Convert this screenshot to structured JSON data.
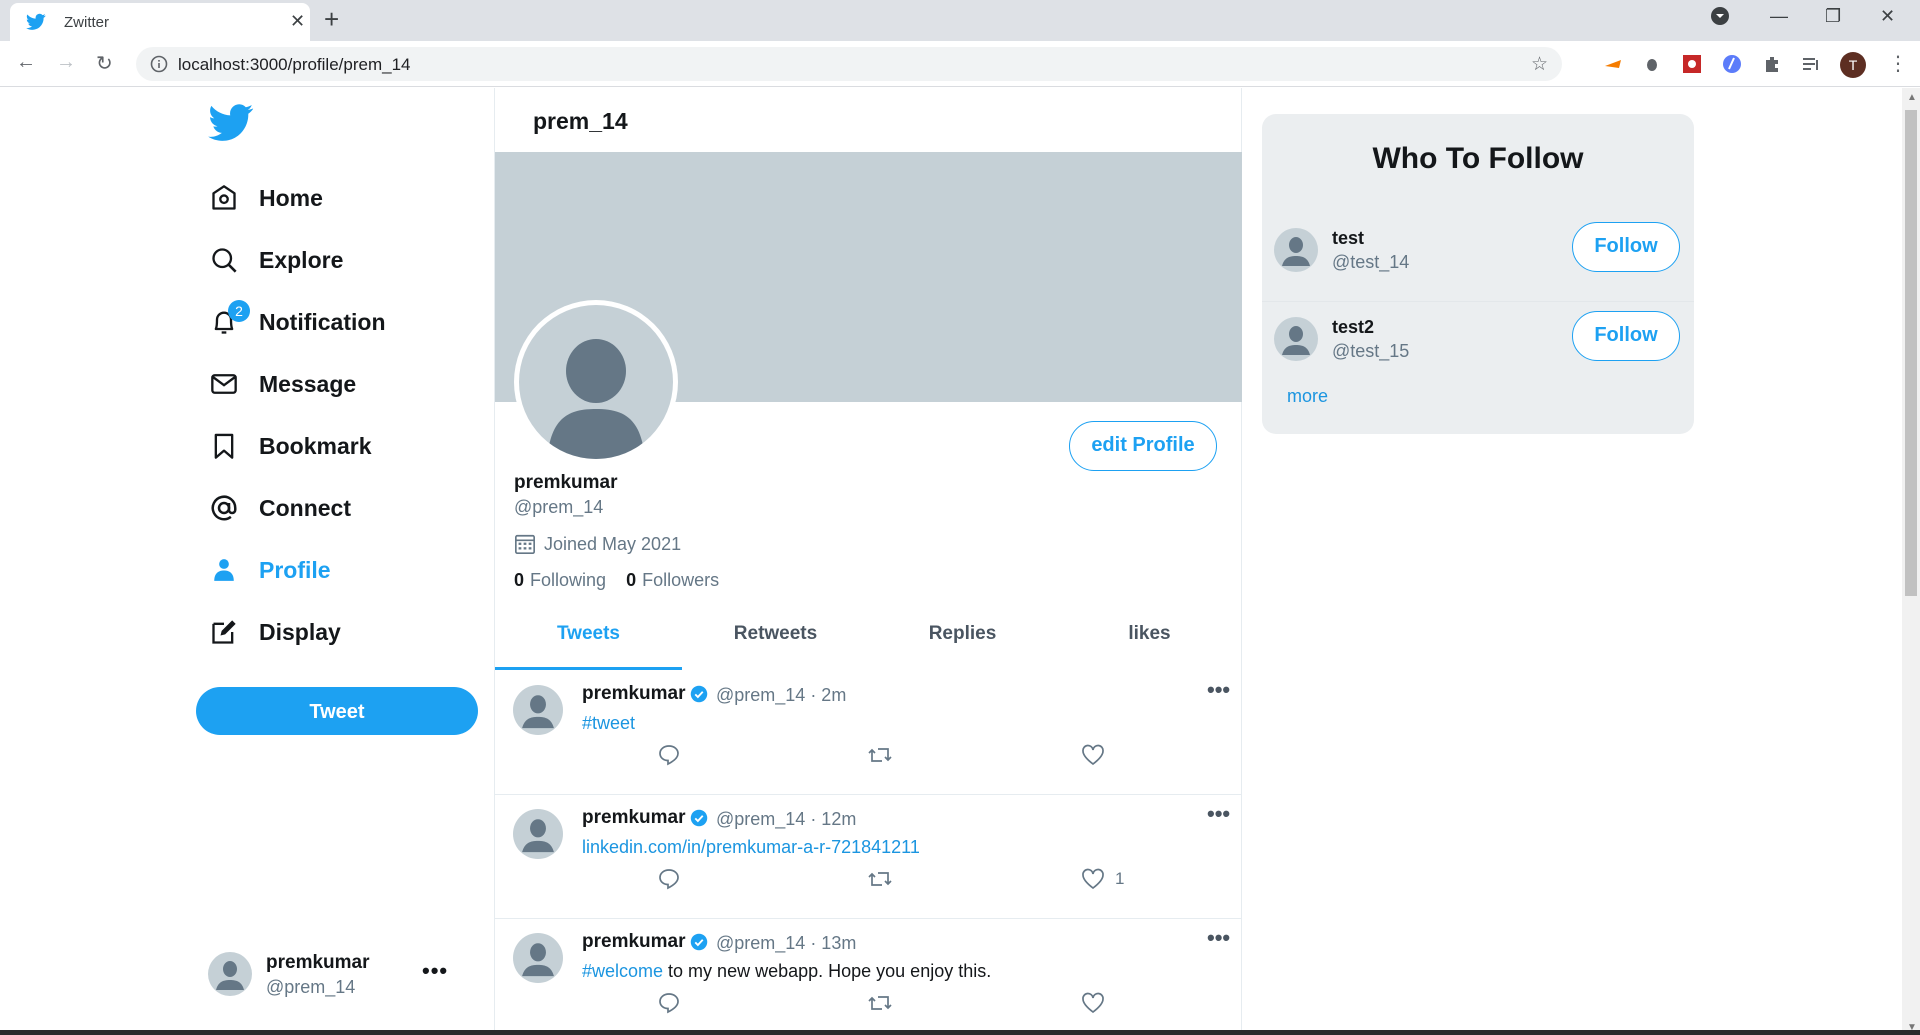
{
  "browser": {
    "tab_title": "Zwitter",
    "tab_close": "✕",
    "new_tab": "+",
    "url": "localhost:3000/profile/prem_14",
    "profile_initial": "T"
  },
  "nav": {
    "items": [
      {
        "label": "Home",
        "icon": "home-icon"
      },
      {
        "label": "Explore",
        "icon": "search-icon"
      },
      {
        "label": "Notification",
        "icon": "bell-icon",
        "badge": "2"
      },
      {
        "label": "Message",
        "icon": "mail-icon"
      },
      {
        "label": "Bookmark",
        "icon": "bookmark-icon"
      },
      {
        "label": "Connect",
        "icon": "at-icon"
      },
      {
        "label": "Profile",
        "icon": "person-icon",
        "active": true
      },
      {
        "label": "Display",
        "icon": "edit-icon"
      }
    ],
    "tweet_button": "Tweet",
    "current_user": {
      "name": "premkumar",
      "handle": "@prem_14",
      "more": "•••"
    }
  },
  "profile": {
    "header_title": "prem_14",
    "edit_button": "edit Profile",
    "name": "premkumar",
    "handle": "@prem_14",
    "joined": "Joined May 2021",
    "following_count": "0",
    "following_label": "Following",
    "followers_count": "0",
    "followers_label": "Followers",
    "tabs": [
      "Tweets",
      "Retweets",
      "Replies",
      "likes"
    ],
    "active_tab": "Tweets"
  },
  "tweets": [
    {
      "name": "premkumar",
      "meta": "@prem_14 · 2m",
      "link": "#tweet",
      "text": "",
      "likes": ""
    },
    {
      "name": "premkumar",
      "meta": "@prem_14 · 12m",
      "link": "linkedin.com/in/premkumar-a-r-721841211",
      "text": "",
      "likes": "1"
    },
    {
      "name": "premkumar",
      "meta": "@prem_14 · 13m",
      "link": "#welcome",
      "text": " to my new webapp. Hope you enjoy this.",
      "likes": ""
    }
  ],
  "tweet_more": "•••",
  "who_to_follow": {
    "title": "Who To Follow",
    "users": [
      {
        "name": "test",
        "handle": "@test_14",
        "button": "Follow"
      },
      {
        "name": "test2",
        "handle": "@test_15",
        "button": "Follow"
      }
    ],
    "more": "more"
  },
  "colors": {
    "accent": "#1da1f2",
    "banner": "#c5d0d6",
    "avatar_fg": "#657786"
  }
}
